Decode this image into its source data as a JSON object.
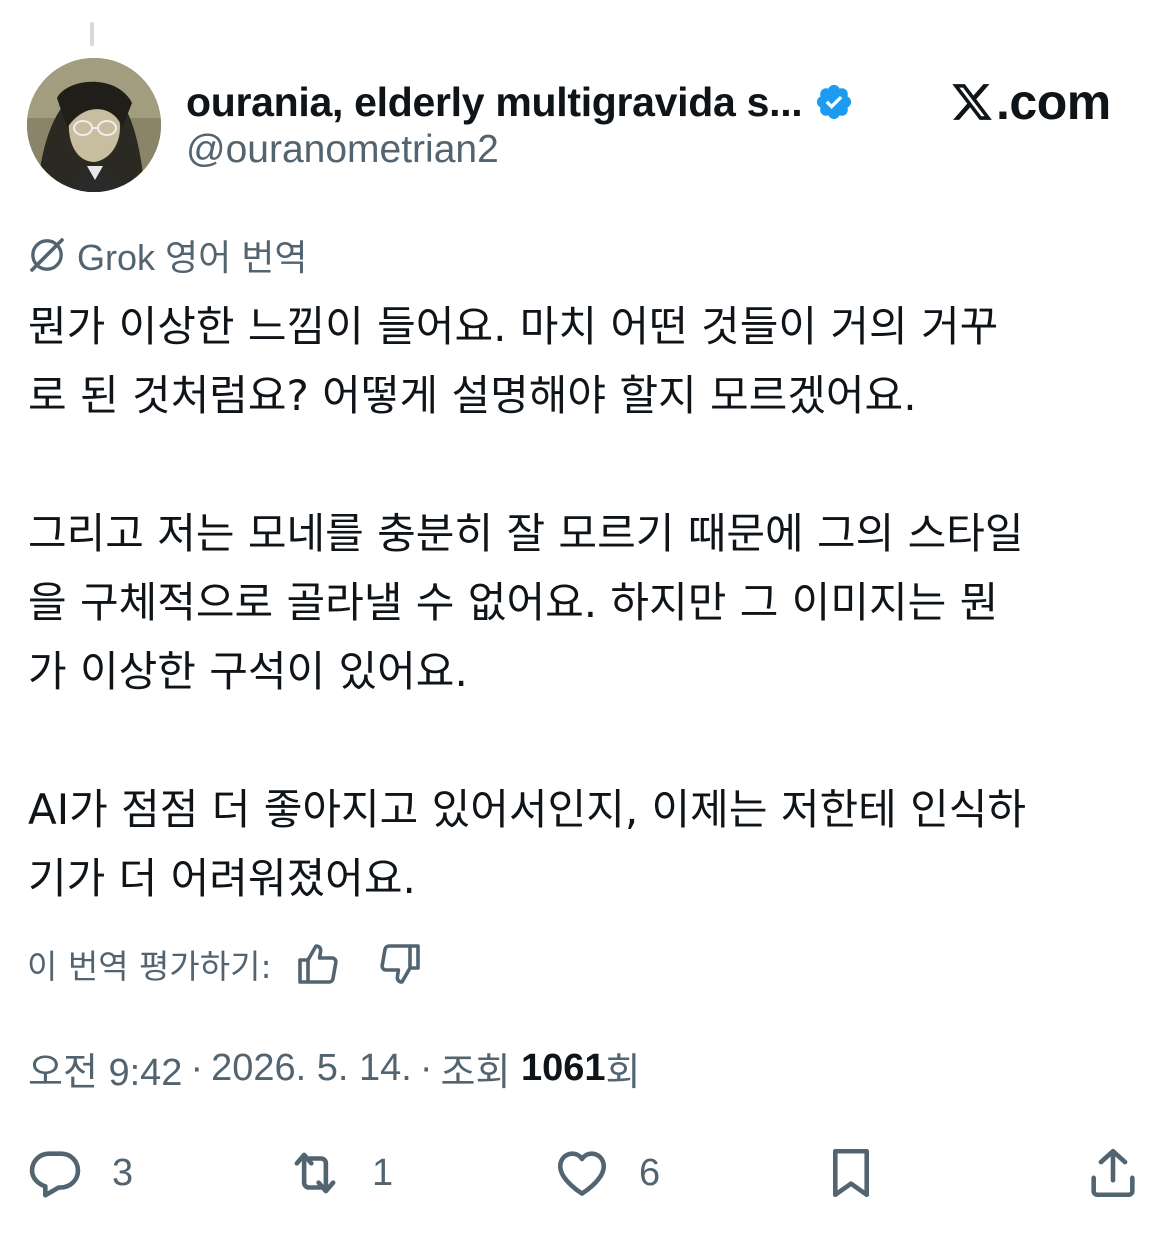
{
  "author": {
    "display_name": "ourania, elderly multigravida s...",
    "handle": "@ouranometrian2",
    "verified": true,
    "verified_icon": "verified-badge-icon"
  },
  "brand": {
    "icon": "x-logo-icon",
    "text": ".com"
  },
  "translation": {
    "label": "Grok 영어 번역",
    "icon": "grok-icon"
  },
  "tweet": {
    "paragraphs": [
      "뭔가 이상한 느낌이 들어요. 마치 어떤 것들이 거의 거꾸\n로 된 것처럼요? 어떻게 설명해야 할지 모르겠어요.",
      "그리고 저는 모네를 충분히 잘 모르기 때문에 그의 스타일\n을 구체적으로 골라낼 수 없어요. 하지만 그 이미지는 뭔\n가 이상한 구석이 있어요.",
      "AI가 점점 더 좋아지고 있어서인지, 이제는 저한테 인식하\n기가 더 어려워졌어요."
    ]
  },
  "rating": {
    "label": "이 번역 평가하기:",
    "up_icon": "thumbs-up-icon",
    "down_icon": "thumbs-down-icon"
  },
  "meta": {
    "time": "오전 9:42",
    "separator": "·",
    "date": "2026. 5. 14.",
    "views_prefix": "조회",
    "views_count": "1061",
    "views_suffix": "회"
  },
  "actions": {
    "reply_count": "3",
    "repost_count": "1",
    "like_count": "6"
  },
  "colors": {
    "text_primary": "#0f1419",
    "text_secondary": "#536471",
    "verified_blue": "#1d9bf0"
  }
}
